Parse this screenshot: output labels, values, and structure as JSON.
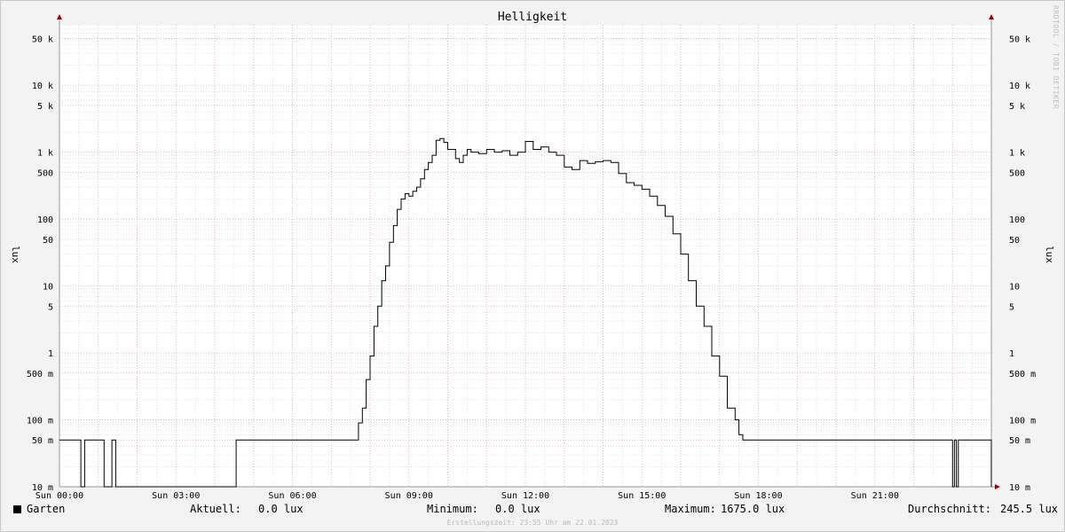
{
  "watermark": "RRDTOOL / TOBI OETIKER",
  "legend": {
    "series_label": "Garten",
    "current_label": "Aktuell:",
    "current_value": "0.0 lux",
    "minimum_label": "Minimum:",
    "minimum_value": "0.0 lux",
    "maximum_label": "Maximum:",
    "maximum_value": "1675.0 lux",
    "average_label": "Durchschnitt:",
    "average_value": "245.5 lux"
  },
  "footer": "Erstellungszeit: 23:55 Uhr am 22.01.2023",
  "colors": {
    "background": "#f3f3f3",
    "plot_background": "#ffffff",
    "major_grid": "#e8a0a0",
    "minor_grid": "#d0d0d0",
    "series": "#000000",
    "axis_arrow": "#a00000"
  },
  "chart_data": {
    "type": "line",
    "title": "Helligkeit",
    "ylabel": "lux",
    "yscale": "log",
    "ylim": [
      0.01,
      80000
    ],
    "xlim": [
      0,
      24
    ],
    "grid": true,
    "x_ticks": [
      {
        "value": 0,
        "label": "Sun 00:00"
      },
      {
        "value": 3,
        "label": "Sun 03:00"
      },
      {
        "value": 6,
        "label": "Sun 06:00"
      },
      {
        "value": 9,
        "label": "Sun 09:00"
      },
      {
        "value": 12,
        "label": "Sun 12:00"
      },
      {
        "value": 15,
        "label": "Sun 15:00"
      },
      {
        "value": 18,
        "label": "Sun 18:00"
      },
      {
        "value": 21,
        "label": "Sun 21:00"
      }
    ],
    "y_ticks": [
      {
        "value": 0.01,
        "label": "10 m"
      },
      {
        "value": 0.05,
        "label": "50 m"
      },
      {
        "value": 0.1,
        "label": "100 m"
      },
      {
        "value": 0.5,
        "label": "500 m"
      },
      {
        "value": 1,
        "label": "1"
      },
      {
        "value": 5,
        "label": "5"
      },
      {
        "value": 10,
        "label": "10"
      },
      {
        "value": 50,
        "label": "50"
      },
      {
        "value": 100,
        "label": "100"
      },
      {
        "value": 500,
        "label": "500"
      },
      {
        "value": 1000,
        "label": "1 k"
      },
      {
        "value": 5000,
        "label": "5 k"
      },
      {
        "value": 10000,
        "label": "10 k"
      },
      {
        "value": 50000,
        "label": "50 k"
      }
    ],
    "series": [
      {
        "name": "Garten",
        "x": [
          0,
          0.5,
          0.55,
          0.65,
          1.1,
          1.15,
          1.3,
          1.35,
          1.45,
          4.5,
          4.55,
          7.4,
          7.7,
          7.8,
          7.9,
          8.0,
          8.1,
          8.2,
          8.3,
          8.4,
          8.5,
          8.6,
          8.7,
          8.8,
          8.9,
          9.0,
          9.1,
          9.2,
          9.3,
          9.4,
          9.5,
          9.6,
          9.7,
          9.8,
          9.9,
          10.0,
          10.2,
          10.3,
          10.4,
          10.5,
          10.6,
          10.8,
          11.0,
          11.2,
          11.4,
          11.6,
          11.8,
          12.0,
          12.2,
          12.4,
          12.6,
          12.8,
          13.0,
          13.2,
          13.4,
          13.6,
          13.8,
          14.0,
          14.2,
          14.4,
          14.6,
          14.8,
          15.0,
          15.2,
          15.4,
          15.6,
          15.8,
          16.0,
          16.2,
          16.4,
          16.6,
          16.8,
          17.0,
          17.2,
          17.4,
          17.5,
          17.6,
          17.7,
          17.8,
          17.9,
          18.0,
          21.0,
          22.9,
          23.0,
          23.05,
          23.1,
          23.15,
          24.0
        ],
        "y": [
          0.05,
          0.05,
          0.01,
          0.05,
          0.05,
          0.01,
          0.01,
          0.05,
          0.01,
          0.01,
          0.05,
          0.05,
          0.09,
          0.15,
          0.4,
          0.9,
          2.5,
          5,
          12,
          20,
          45,
          80,
          140,
          200,
          240,
          220,
          260,
          300,
          400,
          550,
          700,
          900,
          1500,
          1600,
          1400,
          1100,
          800,
          700,
          900,
          1100,
          1000,
          950,
          1100,
          1000,
          1050,
          900,
          1000,
          1450,
          1100,
          1200,
          1000,
          900,
          600,
          550,
          750,
          680,
          720,
          750,
          700,
          480,
          350,
          320,
          280,
          220,
          160,
          110,
          60,
          30,
          12,
          5,
          2.5,
          0.9,
          0.45,
          0.15,
          0.1,
          0.06,
          0.05,
          0.05,
          0.05,
          0.05,
          0.05,
          0.05,
          0.05,
          0.01,
          0.05,
          0.01,
          0.05,
          0.01
        ]
      }
    ]
  }
}
